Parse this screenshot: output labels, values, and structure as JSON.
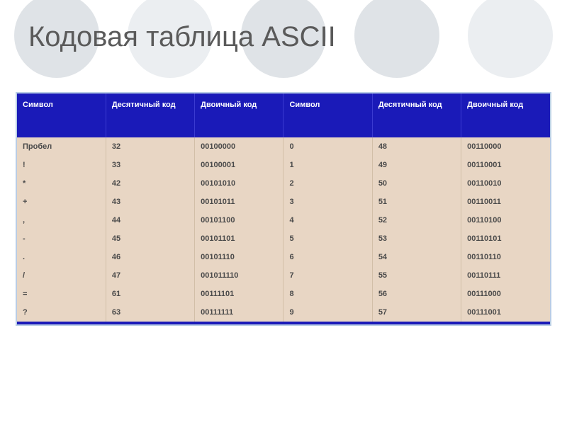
{
  "title": "Кодовая таблица ASCII",
  "headers": {
    "c0": "Символ",
    "c1": "Десятичный код",
    "c2": "Двоичный код",
    "c3": "Символ",
    "c4": "Десятичный код",
    "c5": "Двоичный код"
  },
  "rows": [
    {
      "s1": "Пробел",
      "d1": "32",
      "b1": "00100000",
      "s2": "0",
      "d2": "48",
      "b2": "00110000"
    },
    {
      "s1": "!",
      "d1": "33",
      "b1": "00100001",
      "s2": "1",
      "d2": "49",
      "b2": "00110001"
    },
    {
      "s1": "*",
      "d1": "42",
      "b1": "00101010",
      "s2": "2",
      "d2": "50",
      "b2": "00110010"
    },
    {
      "s1": "+",
      "d1": "43",
      "b1": "00101011",
      "s2": "3",
      "d2": "51",
      "b2": "00110011"
    },
    {
      "s1": ",",
      "d1": "44",
      "b1": "00101100",
      "s2": "4",
      "d2": "52",
      "b2": "00110100"
    },
    {
      "s1": "-",
      "d1": "45",
      "b1": "00101101",
      "s2": "5",
      "d2": "53",
      "b2": "00110101"
    },
    {
      "s1": ".",
      "d1": "46",
      "b1": "00101110",
      "s2": "6",
      "d2": "54",
      "b2": "00110110"
    },
    {
      "s1": "/",
      "d1": "47",
      "b1": "001011110",
      "s2": "7",
      "d2": "55",
      "b2": "00110111"
    },
    {
      "s1": "=",
      "d1": "61",
      "b1": "00111101",
      "s2": "8",
      "d2": "56",
      "b2": "00111000"
    },
    {
      "s1": "?",
      "d1": "63",
      "b1": "00111111",
      "s2": "9",
      "d2": "57",
      "b2": "00111001"
    }
  ]
}
